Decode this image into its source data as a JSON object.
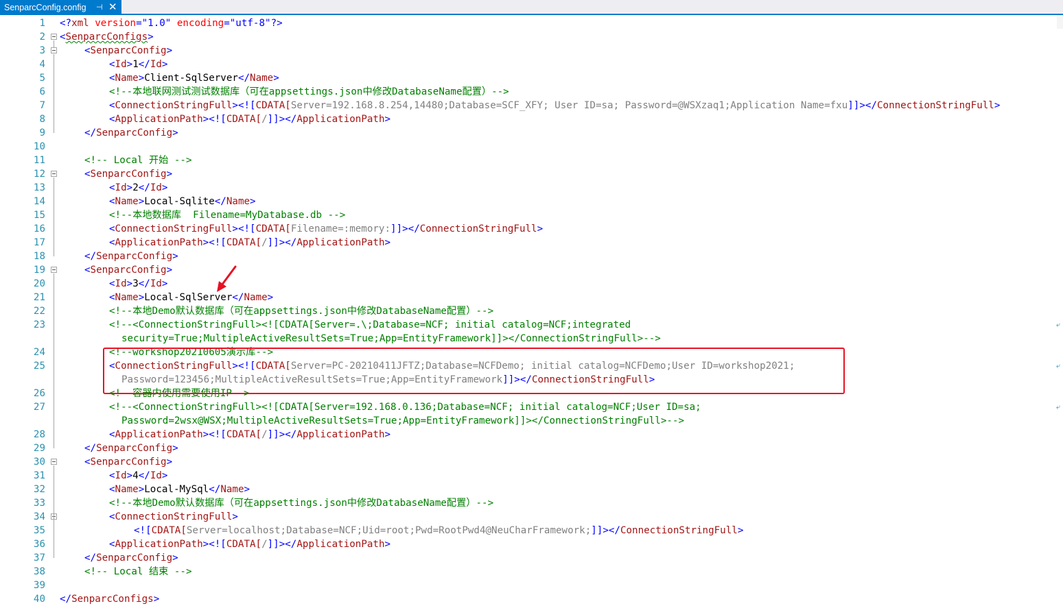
{
  "tab": {
    "title": "SenparcConfig.config",
    "pin_glyph": "⊣",
    "close_glyph": "✕"
  },
  "lines": [
    {
      "n": "1"
    },
    {
      "n": "2"
    },
    {
      "n": "3"
    },
    {
      "n": "4"
    },
    {
      "n": "5"
    },
    {
      "n": "6"
    },
    {
      "n": "7"
    },
    {
      "n": "8"
    },
    {
      "n": "9"
    },
    {
      "n": "10"
    },
    {
      "n": "11"
    },
    {
      "n": "12"
    },
    {
      "n": "13"
    },
    {
      "n": "14"
    },
    {
      "n": "15"
    },
    {
      "n": "16"
    },
    {
      "n": "17"
    },
    {
      "n": "18"
    },
    {
      "n": "19"
    },
    {
      "n": "20"
    },
    {
      "n": "21"
    },
    {
      "n": "22"
    },
    {
      "n": "23"
    },
    {
      "n": "24"
    },
    {
      "n": "25"
    },
    {
      "n": "26"
    },
    {
      "n": "27"
    },
    {
      "n": "28"
    },
    {
      "n": "29"
    },
    {
      "n": "30"
    },
    {
      "n": "31"
    },
    {
      "n": "32"
    },
    {
      "n": "33"
    },
    {
      "n": "34"
    },
    {
      "n": "35"
    },
    {
      "n": "36"
    },
    {
      "n": "37"
    },
    {
      "n": "38"
    },
    {
      "n": "39"
    },
    {
      "n": "40"
    }
  ],
  "text": {
    "xml_decl_open": "<?",
    "xml_name": "xml",
    "xml_version_attr": "version",
    "xml_version_val": "\"1.0\"",
    "xml_encoding_attr": "encoding",
    "xml_encoding_val": "\"utf-8\"",
    "xml_decl_close": "?>",
    "root_tag": "SenparcConfigs",
    "cfg_tag": "SenparcConfig",
    "id_tag": "Id",
    "name_tag": "Name",
    "conn_tag": "ConnectionStringFull",
    "app_tag": "ApplicationPath",
    "cdata_open": "<![",
    "cdata_kw": "CDATA[",
    "cdata_close": "]]>",
    "app_path_value": "/",
    "id1": "1",
    "name1": "Client-SqlServer",
    "comment6": "<!--本地联网测试测试数据库（可在appsettings.json中修改DatabaseName配置）-->",
    "conn7_value": "Server=192.168.8.254,14480;Database=SCF_XFY; User ID=sa; Password=@WSXzaq1;Application Name=fxu",
    "comment11": "<!-- Local 开始 -->",
    "id2": "2",
    "name2": "Local-Sqlite",
    "comment15": "<!--本地数据库  Filename=MyDatabase.db -->",
    "conn16_value": "Filename=:memory:",
    "id3": "3",
    "name3": "Local-SqlServer",
    "comment22": "<!--本地Demo默认数据库（可在appsettings.json中修改DatabaseName配置）-->",
    "comment23a": "<!--<ConnectionStringFull><![CDATA[Server=.\\;Database=NCF; initial catalog=NCF;integrated",
    "comment23b": "security=True;MultipleActiveResultSets=True;App=EntityFramework]]></ConnectionStringFull>-->",
    "comment24": "<!--workshop20210605演示库-->",
    "conn25_value_a": "Server=PC-20210411JFTZ;Database=NCFDemo; initial catalog=NCFDemo;User ID=workshop2021;",
    "conn25_value_b": "Password=123456;MultipleActiveResultSets=True;App=EntityFramework",
    "comment26": "<!--容器内使用需要使用IP-->",
    "comment27a": "<!--<ConnectionStringFull><![CDATA[Server=192.168.0.136;Database=NCF; initial catalog=NCF;User ID=sa;",
    "comment27b": "Password=2wsx@WSX;MultipleActiveResultSets=True;App=EntityFramework]]></ConnectionStringFull>-->",
    "id4": "4",
    "name4": "Local-MySql",
    "comment33": "<!--本地Demo默认数据库（可在appsettings.json中修改DatabaseName配置）-->",
    "conn35_value": "Server=localhost;Database=NCF;Uid=root;Pwd=RootPwd4@NeuCharFramework;",
    "comment38": "<!-- Local 结束 -->",
    "wrap_glyph": "⤶"
  },
  "colors": {
    "bracket": "#0000ff",
    "tag": "#a31515",
    "attr": "#ff0000",
    "comment": "#008000",
    "cdata_text": "#808080",
    "line_number": "#2b91af",
    "tab_active": "#007acc",
    "highlight_box": "#e81123",
    "annotation_arrow": "#e81123"
  },
  "icons": {
    "arrow": "red-annotation-arrow-icon",
    "fold": "collapse-minus-icon",
    "wrap": "word-wrap-glyph-icon"
  }
}
